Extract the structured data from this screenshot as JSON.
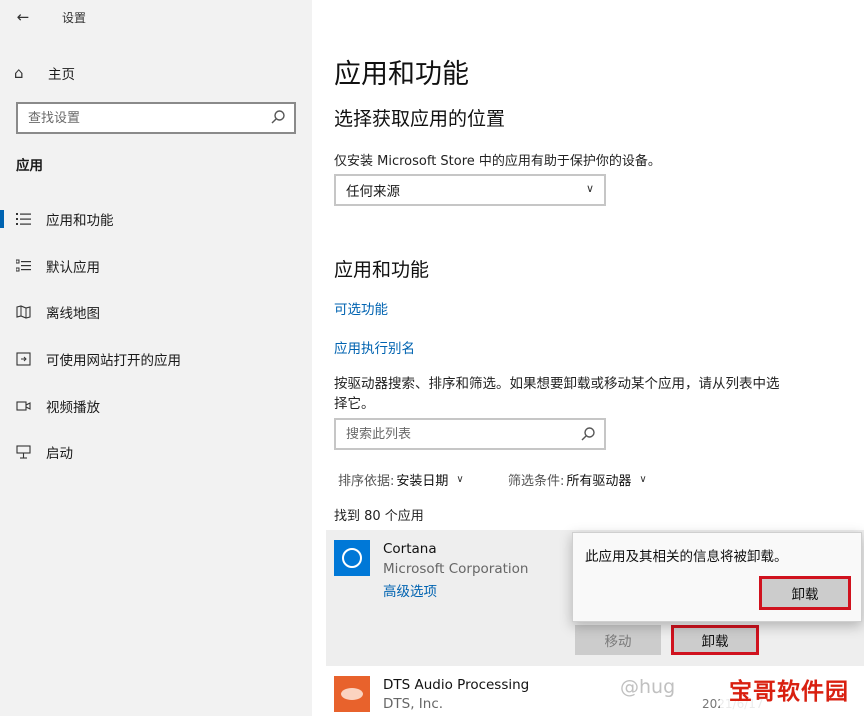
{
  "window": {
    "title": "设置"
  },
  "sidebar": {
    "home_label": "主页",
    "search_placeholder": "查找设置",
    "section_title": "应用",
    "items": [
      {
        "label": "应用和功能",
        "icon": "list-icon",
        "active": true
      },
      {
        "label": "默认应用",
        "icon": "list-check-icon",
        "active": false
      },
      {
        "label": "离线地图",
        "icon": "map-icon",
        "active": false
      },
      {
        "label": "可使用网站打开的应用",
        "icon": "open-window-icon",
        "active": false
      },
      {
        "label": "视频播放",
        "icon": "video-icon",
        "active": false
      },
      {
        "label": "启动",
        "icon": "startup-icon",
        "active": false
      }
    ]
  },
  "main": {
    "title": "应用和功能",
    "source_section": {
      "heading": "选择获取应用的位置",
      "description": "仅安装 Microsoft Store 中的应用有助于保护你的设备。",
      "selected": "任何来源"
    },
    "apps_section": {
      "heading": "应用和功能",
      "optional_features_link": "可选功能",
      "alias_link": "应用执行别名",
      "description": "按驱动器搜索、排序和筛选。如果想要卸载或移动某个应用，请从列表中选择它。",
      "search_placeholder": "搜索此列表",
      "sort_label": "排序依据:",
      "sort_value": "安装日期",
      "filter_label": "筛选条件:",
      "filter_value": "所有驱动器",
      "found_text": "找到 80 个应用"
    },
    "apps": [
      {
        "name": "Cortana",
        "publisher": "Microsoft Corporation",
        "advanced_link": "高级选项",
        "move_label": "移动",
        "uninstall_label": "卸载"
      },
      {
        "name": "DTS Audio Processing",
        "publisher": "DTS, Inc.",
        "date": "2021/6/17"
      }
    ],
    "flyout": {
      "message": "此应用及其相关的信息将被卸载。",
      "confirm_label": "卸载"
    }
  },
  "watermark": {
    "text": "@hug",
    "logo": "宝哥软件园"
  },
  "colors": {
    "accent": "#0063b1",
    "highlight_border": "#d0121e",
    "sidebar_bg": "#f2f2f2"
  }
}
